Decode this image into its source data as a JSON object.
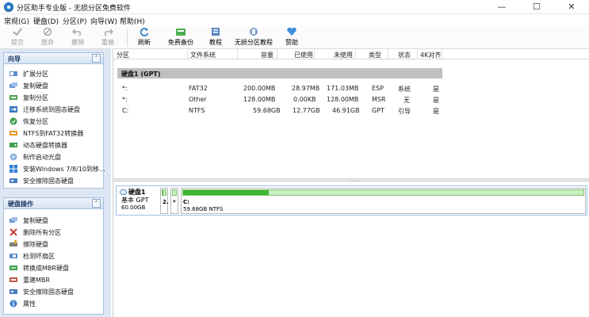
{
  "window": {
    "title": "分区助手专业版 - 无损分区免费软件",
    "minimize": "—",
    "maximize": "☐",
    "close": "✕"
  },
  "menu": [
    "常规(G)",
    "硬盘(D)",
    "分区(P)",
    "向导(W)",
    "帮助(H)"
  ],
  "toolbar": [
    {
      "label": "提交",
      "icon": "commit-icon",
      "enabled": false
    },
    {
      "label": "放弃",
      "icon": "discard-icon",
      "enabled": false
    },
    {
      "label": "撤销",
      "icon": "undo-icon",
      "enabled": false
    },
    {
      "label": "重做",
      "icon": "redo-icon",
      "enabled": false
    },
    {
      "label": "刷新",
      "icon": "refresh-icon",
      "enabled": true
    },
    {
      "label": "免费备份",
      "icon": "backup-icon",
      "enabled": true
    },
    {
      "label": "教程",
      "icon": "tutorial-icon",
      "enabled": true
    },
    {
      "label": "无损分区教程",
      "icon": "lossless-tutorial-icon",
      "enabled": true
    },
    {
      "label": "赞助",
      "icon": "sponsor-heart-icon",
      "enabled": true
    }
  ],
  "sidebar": {
    "wizard": {
      "title": "向导",
      "collapse": "⌃",
      "items": [
        {
          "label": "扩展分区",
          "icon": "extend-partition-icon"
        },
        {
          "label": "复制硬盘",
          "icon": "copy-disk-icon"
        },
        {
          "label": "复制分区",
          "icon": "copy-partition-icon"
        },
        {
          "label": "迁移系统到固态硬盘",
          "icon": "migrate-os-icon"
        },
        {
          "label": "恢复分区",
          "icon": "recover-partition-icon"
        },
        {
          "label": "NTFS到FAT32转换器",
          "icon": "ntfs-fat32-icon"
        },
        {
          "label": "动态硬盘转换器",
          "icon": "dynamic-disk-icon"
        },
        {
          "label": "制作启动光盘",
          "icon": "boot-disc-icon"
        },
        {
          "label": "安装Windows 7/8/10到移...",
          "icon": "windows-to-go-icon"
        },
        {
          "label": "安全擦除固态硬盘",
          "icon": "ssd-erase-icon"
        }
      ]
    },
    "disk_ops": {
      "title": "硬盘操作",
      "collapse": "⌃",
      "items": [
        {
          "label": "复制硬盘",
          "icon": "copy-disk-icon"
        },
        {
          "label": "删除所有分区",
          "icon": "delete-partitions-icon"
        },
        {
          "label": "擦除硬盘",
          "icon": "wipe-disk-icon"
        },
        {
          "label": "检测坏扇区",
          "icon": "bad-sector-icon"
        },
        {
          "label": "转换成MBR硬盘",
          "icon": "convert-mbr-icon"
        },
        {
          "label": "重建MBR",
          "icon": "rebuild-mbr-icon"
        },
        {
          "label": "安全擦除固态硬盘",
          "icon": "ssd-erase-icon"
        },
        {
          "label": "属性",
          "icon": "properties-icon"
        }
      ]
    }
  },
  "table": {
    "columns": [
      "分区",
      "文件系统",
      "容量",
      "已使用",
      "未使用",
      "类型",
      "状态",
      "4K对齐"
    ],
    "disk_label": "硬盘1 (GPT)",
    "rows": [
      [
        "*:",
        "FAT32",
        "200.00MB",
        "28.97MB",
        "171.03MB",
        "ESP",
        "系统",
        "是"
      ],
      [
        "*:",
        "Other",
        "128.00MB",
        "0.00KB",
        "128.00MB",
        "MSR",
        "无",
        "是"
      ],
      [
        "C:",
        "NTFS",
        "59.68GB",
        "12.77GB",
        "46.91GB",
        "GPT",
        "引导",
        "是"
      ]
    ]
  },
  "splitter_grip": "......",
  "disk_map": {
    "name": "硬盘1",
    "type": "基本 GPT",
    "size": "60.00GB",
    "partitions": [
      {
        "label": "2.",
        "detail": "",
        "used_fraction": 0.14
      },
      {
        "label": "*",
        "detail": "",
        "used_fraction": 0.0
      },
      {
        "label": "C:",
        "detail": "59.68GB NTFS",
        "used_fraction": 0.214
      }
    ]
  }
}
